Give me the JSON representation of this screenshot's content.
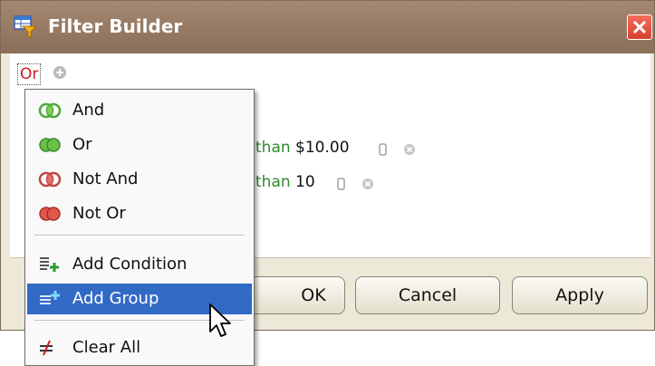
{
  "window": {
    "title": "Filter Builder",
    "close_icon": "close-icon"
  },
  "filter": {
    "root_group": "Or",
    "conditions": [
      {
        "operator_fragment": "than",
        "value": "$10.00"
      },
      {
        "operator_fragment": "than",
        "value": "10"
      }
    ]
  },
  "buttons": {
    "ok": "OK",
    "cancel": "Cancel",
    "apply": "Apply"
  },
  "menu": {
    "items": [
      {
        "label": "And",
        "icon": "and-group-icon"
      },
      {
        "label": "Or",
        "icon": "or-group-icon"
      },
      {
        "label": "Not And",
        "icon": "not-and-group-icon"
      },
      {
        "label": "Not Or",
        "icon": "not-or-group-icon"
      },
      {
        "label": "Add Condition",
        "icon": "add-condition-icon"
      },
      {
        "label": "Add Group",
        "icon": "add-group-icon",
        "highlighted": true
      },
      {
        "label": "Clear All",
        "icon": "clear-all-icon"
      }
    ]
  },
  "colors": {
    "highlight": "#316ac5",
    "group_text": "#d0181c",
    "operator_text": "#2f8a2f"
  }
}
